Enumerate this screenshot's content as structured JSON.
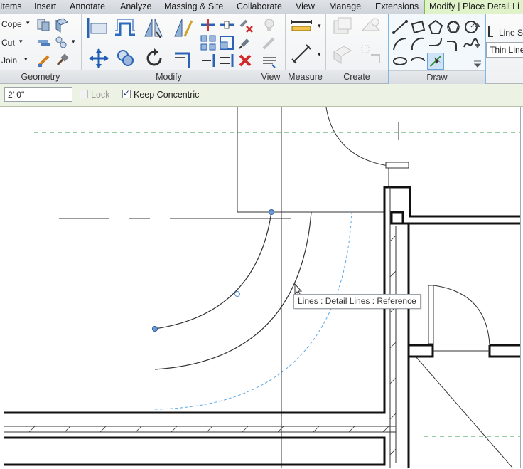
{
  "ribbon_tabs": [
    "Items",
    "Insert",
    "Annotate",
    "Analyze",
    "Massing & Site",
    "Collaborate",
    "View",
    "Manage",
    "Extensions",
    "Modify | Place Detail Li"
  ],
  "active_tab_index": 9,
  "geometry_panel": {
    "title": "Geometry",
    "cope_label": "Cope",
    "cut_label": "Cut",
    "join_label": "Join"
  },
  "modify_panel": {
    "title": "Modify"
  },
  "view_panel": {
    "title": "View"
  },
  "measure_panel": {
    "title": "Measure"
  },
  "create_panel": {
    "title": "Create"
  },
  "draw_panel": {
    "title": "Draw"
  },
  "line_style_panel": {
    "line_style_label": "Line S",
    "line_style_value": "Thin Line"
  },
  "options_bar": {
    "radius_value": "2'  0\"",
    "lock_label": "Lock",
    "lock_checked": false,
    "keep_concentric_label": "Keep Concentric",
    "keep_concentric_checked": true
  },
  "tooltip": {
    "text": "Lines : Detail Lines : Reference"
  },
  "colors": {
    "ribbon_active_tab": "#dff2c9",
    "options_bar_bg": "#edf3e4",
    "reference_line": "#5aa8e6",
    "grid_dash": "#2f9a3a",
    "selected_point": "#5b8fd6"
  }
}
